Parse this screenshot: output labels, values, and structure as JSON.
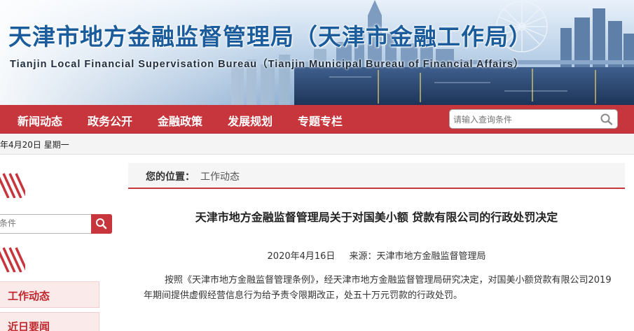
{
  "header": {
    "title": "天津市地方金融监督管理局（天津市金融工作局）",
    "subtitle": "Tianjin Local Financial Supervisation Bureau（Tianjin Municipal Bureau of Financial Affairs）"
  },
  "nav": {
    "items": [
      {
        "label": "新闻动态"
      },
      {
        "label": "政务公开"
      },
      {
        "label": "金融政策"
      },
      {
        "label": "发展规划"
      },
      {
        "label": "专题专栏"
      }
    ],
    "search_placeholder": "请输入查询条件"
  },
  "datebar": {
    "text": "年4月20日  星期一"
  },
  "sidebar": {
    "search_placeholder": "条件",
    "menu": [
      {
        "label": "工作动态"
      },
      {
        "label": "近日要闻"
      }
    ]
  },
  "breadcrumb": {
    "prefix": "您的位置：",
    "current": "工作动态"
  },
  "article": {
    "title": "天津市地方金融监督管理局关于对国美小额 贷款有限公司的行政处罚决定",
    "date": "2020年4月16日",
    "source": "来源：天津市地方金融监督管理局",
    "body": "按照《天津市地方金融监督管理条例》，经天津市地方金融监督管理局研究决定，对国美小额贷款有限公司2019年期间提供虚假经营信息行为给予责令限期改正，处五十万元罚款的行政处罚。"
  },
  "colors": {
    "brand_red": "#c6363c",
    "title_blue": "#1b5c9c",
    "menu_bg": "#fbeaea"
  },
  "icons": {
    "nav_search": "magnifier-icon",
    "sidebar_search": "magnifier-icon"
  }
}
